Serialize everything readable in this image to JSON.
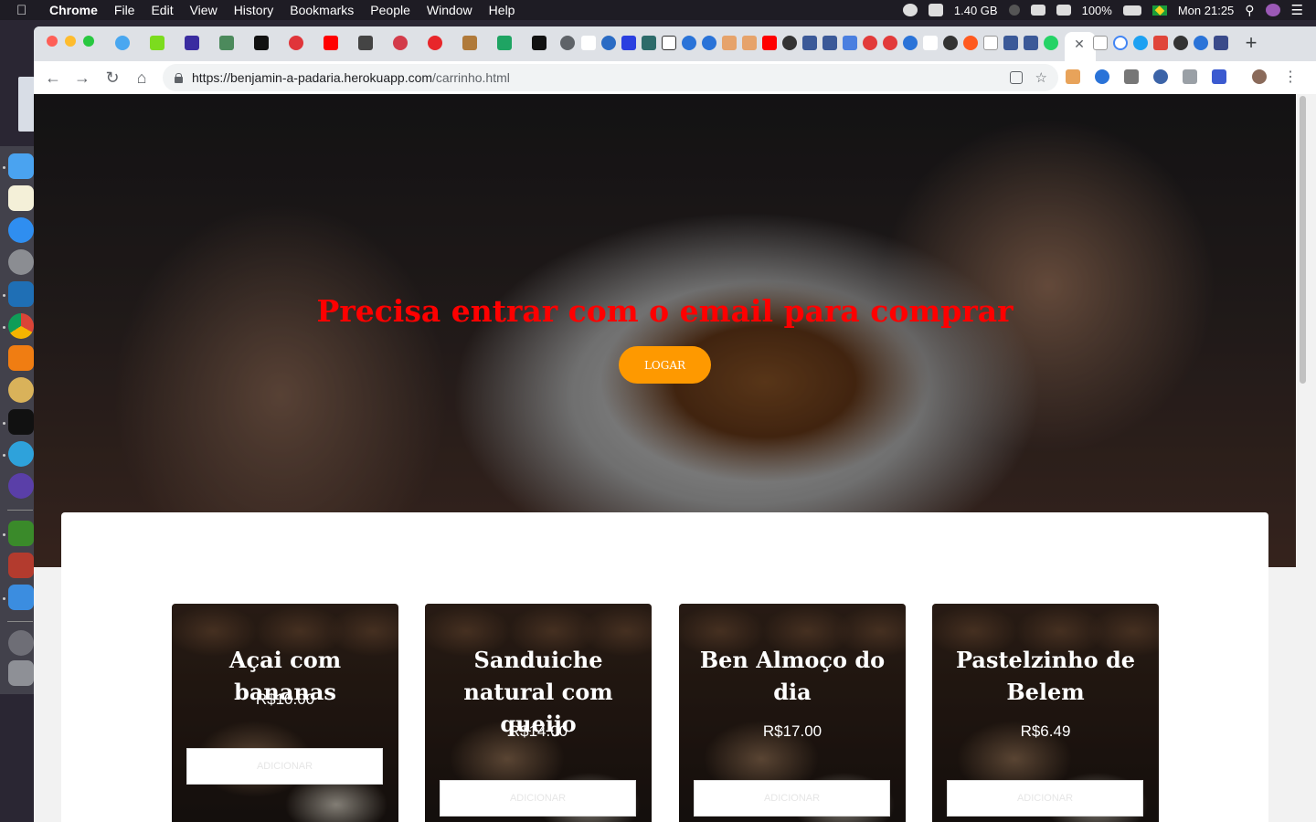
{
  "menubar": {
    "app": "Chrome",
    "items": [
      "File",
      "Edit",
      "View",
      "History",
      "Bookmarks",
      "People",
      "Window",
      "Help"
    ],
    "memory": "1.40 GB",
    "battery": "100%",
    "clock": "Mon 21:25"
  },
  "browser": {
    "url_host": "https://benjamin-a-padaria.herokuapp.com",
    "url_path": "/carrinho.html",
    "tab_close_glyph": "✕",
    "new_tab_glyph": "+"
  },
  "hero": {
    "title": "Precisa entrar com o email para comprar",
    "login_label": "LOGAR",
    "title_color": "#ff0000",
    "button_color": "#fe9900"
  },
  "products": [
    {
      "name": "Açai com bananas",
      "price": "R$10.00",
      "button": "ADICIONAR"
    },
    {
      "name": "Sanduiche natural com queijo",
      "price": "R$14.00",
      "button": "ADICIONAR"
    },
    {
      "name": "Ben Almoço do dia",
      "price": "R$17.00",
      "button": "ADICIONAR"
    },
    {
      "name": "Pastelzinho de Belem",
      "price": "R$6.49",
      "button": "ADICIONAR"
    }
  ]
}
